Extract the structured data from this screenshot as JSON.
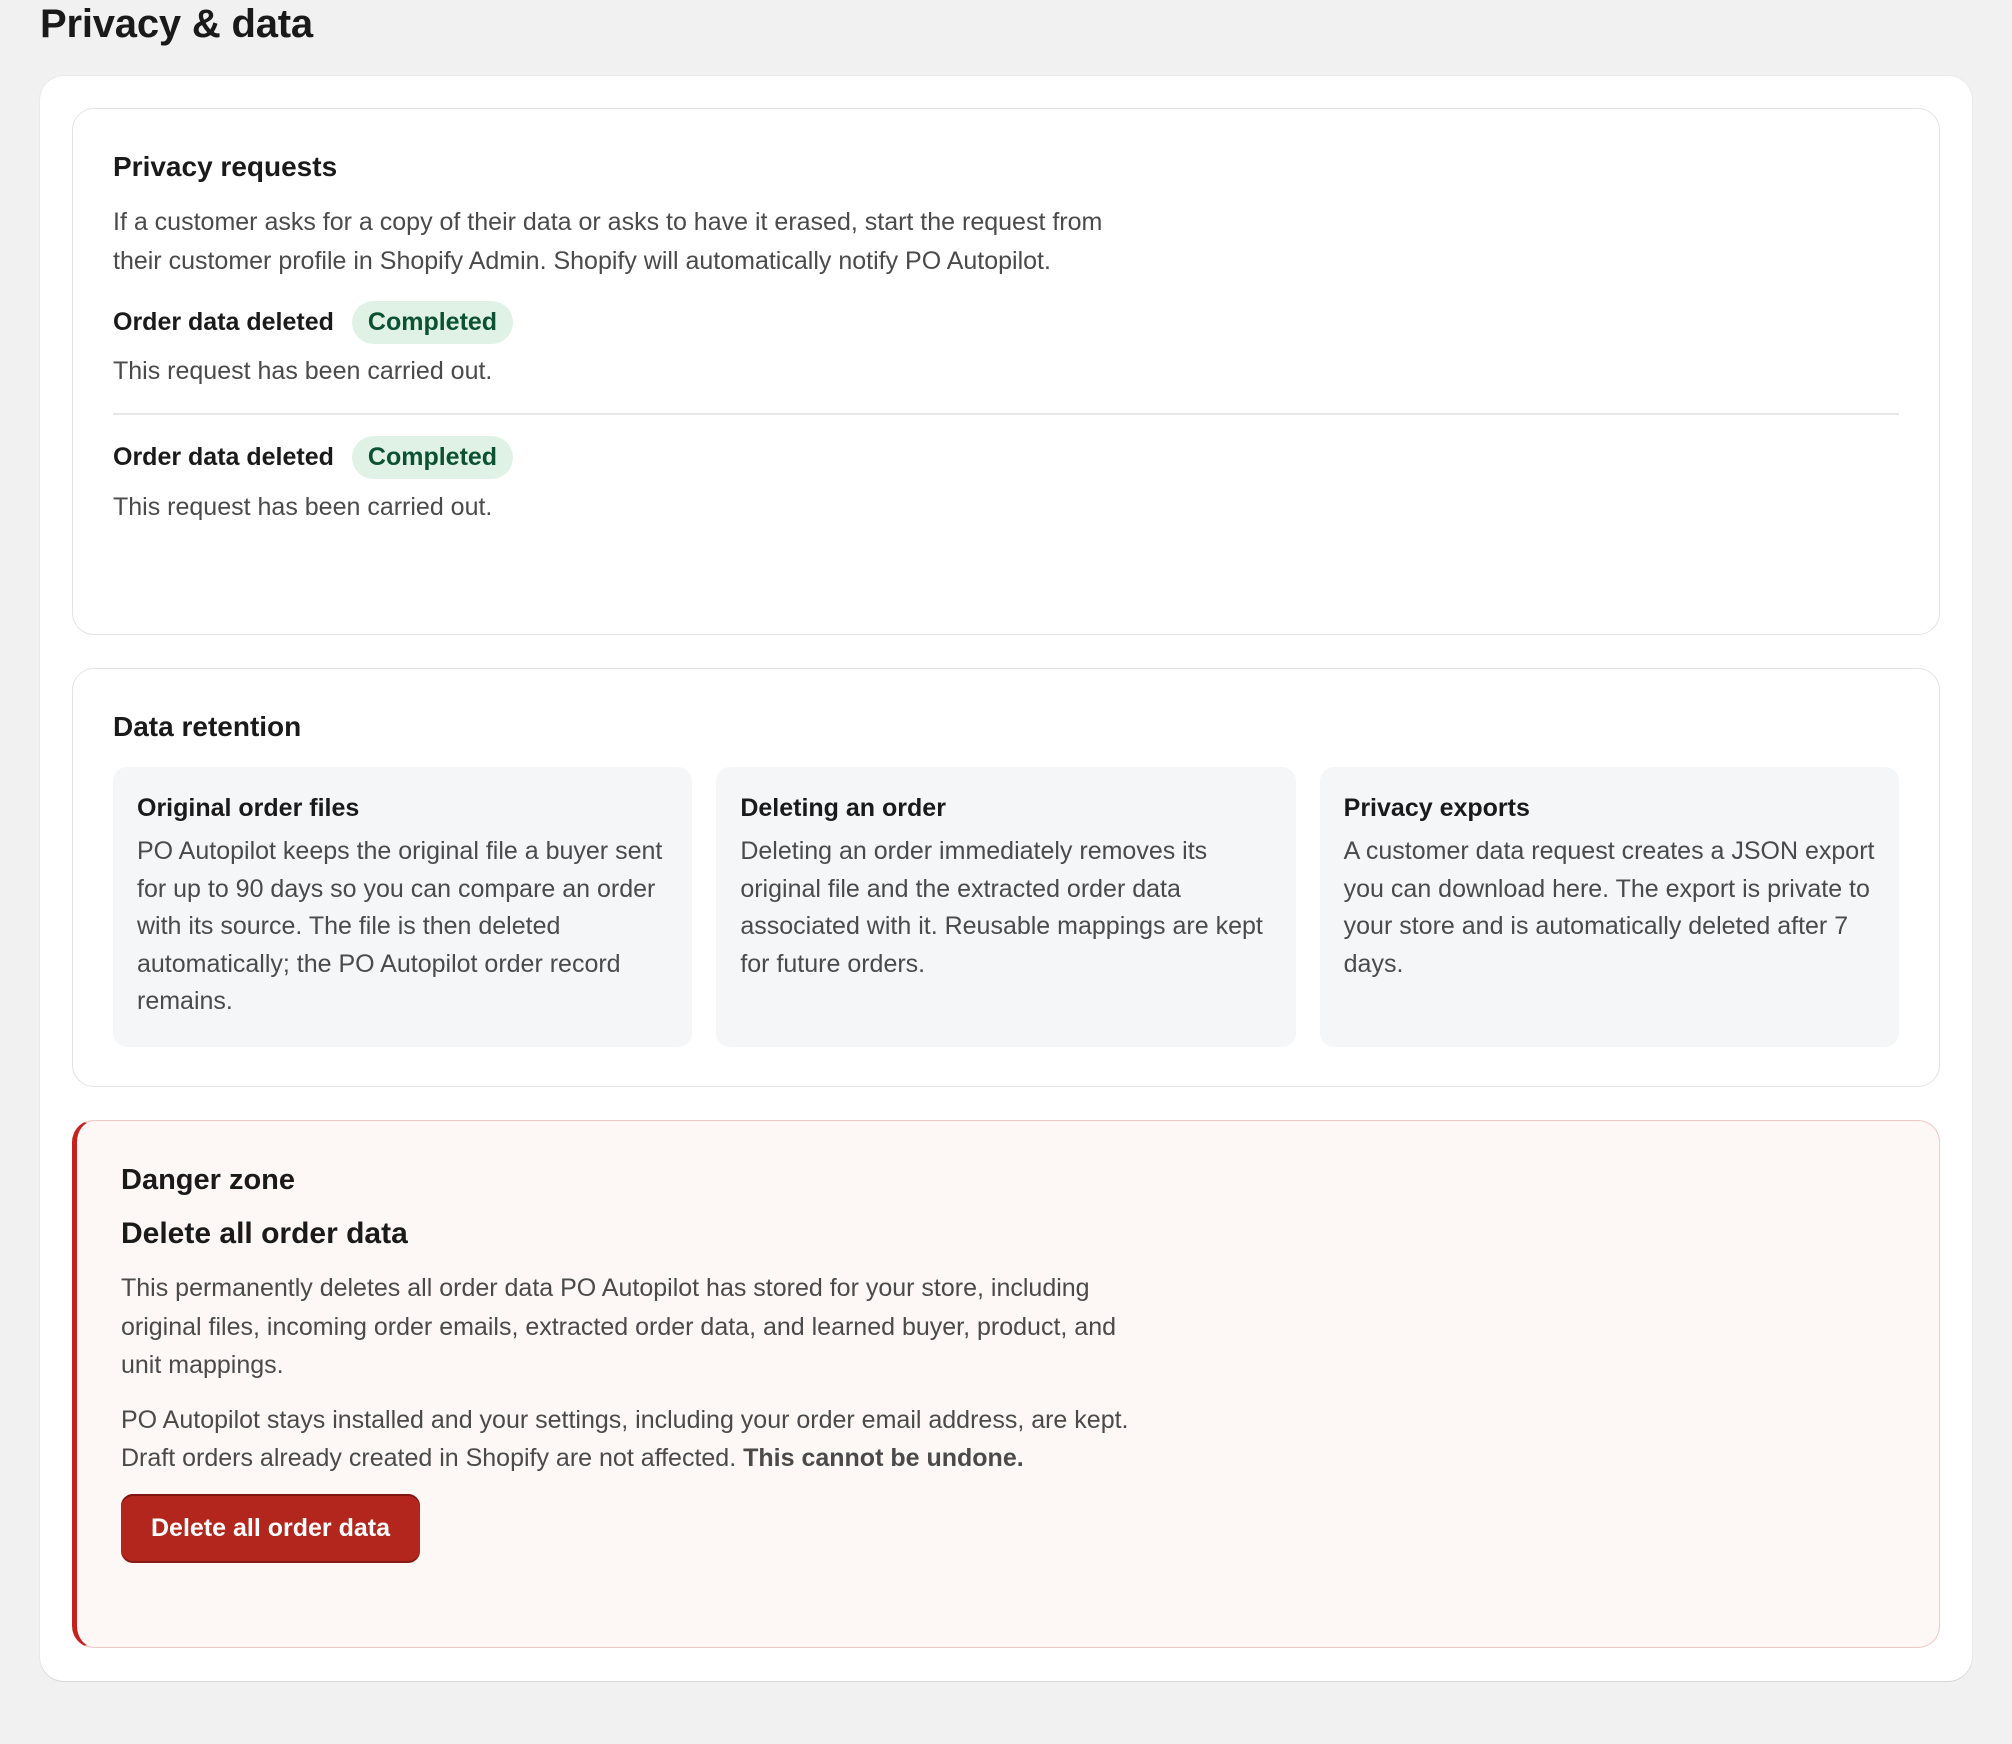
{
  "page": {
    "title": "Privacy & data"
  },
  "privacy_requests": {
    "title": "Privacy requests",
    "description": "If a customer asks for a copy of their data or asks to have it erased, start the request from their customer profile in Shopify Admin. Shopify will automatically notify PO Autopilot.",
    "requests": [
      {
        "title": "Order data deleted",
        "status": "Completed",
        "detail": "This request has been carried out."
      },
      {
        "title": "Order data deleted",
        "status": "Completed",
        "detail": "This request has been carried out."
      }
    ],
    "status_colors": {
      "background": "#dff2e5",
      "text": "#0c5132"
    }
  },
  "data_retention": {
    "title": "Data retention",
    "tiles": [
      {
        "title": "Original order files",
        "text": "PO Autopilot keeps the original file a buyer sent for up to 90 days so you can compare an order with its source. The file is then deleted automatically; the PO Autopilot order record remains."
      },
      {
        "title": "Deleting an order",
        "text": "Deleting an order immediately removes its original file and the extracted order data associated with it. Reusable mappings are kept for future orders."
      },
      {
        "title": "Privacy exports",
        "text": "A customer data request creates a JSON export you can download here. The export is private to your store and is automatically deleted after 7 days."
      }
    ]
  },
  "danger_zone": {
    "kicker": "Danger zone",
    "title": "Delete all order data",
    "paragraph1": "This permanently deletes all order data PO Autopilot has stored for your store, including original files, incoming order emails, extracted order data, and learned buyer, product, and unit mappings.",
    "paragraph2": "PO Autopilot stays installed and your settings, including your order email address, are kept. Draft orders already created in Shopify are not affected.",
    "paragraph2_emphasis": "This cannot be undone.",
    "button_label": "Delete all order data",
    "accent_color": "#c5221f"
  }
}
